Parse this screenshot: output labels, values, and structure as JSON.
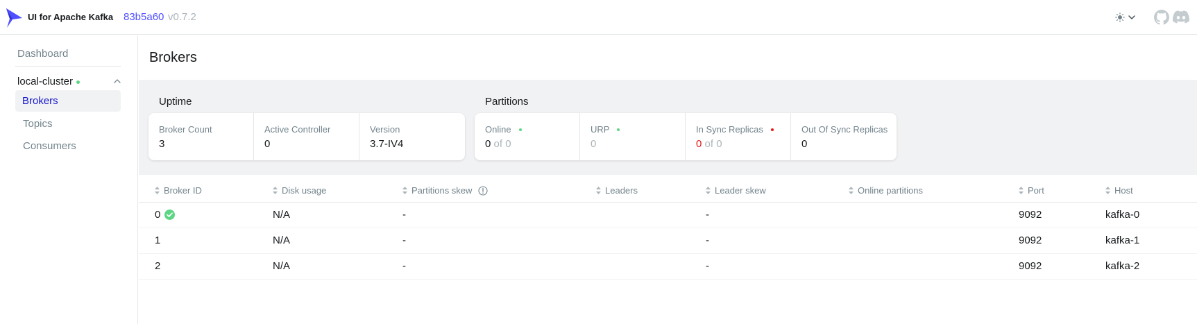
{
  "app": {
    "name": "UI for Apache Kafka",
    "commit": "83b5a60",
    "version": "v0.7.2"
  },
  "sidebar": {
    "dashboard": "Dashboard",
    "cluster": {
      "name": "local-cluster",
      "status_color": "#5CD685"
    },
    "items": [
      {
        "label": "Brokers",
        "active": true
      },
      {
        "label": "Topics",
        "active": false
      },
      {
        "label": "Consumers",
        "active": false
      }
    ]
  },
  "page": {
    "title": "Brokers"
  },
  "uptime": {
    "title": "Uptime",
    "cards": [
      {
        "label": "Broker Count",
        "value": "3"
      },
      {
        "label": "Active Controller",
        "value": "0"
      },
      {
        "label": "Version",
        "value": "3.7-IV4"
      }
    ]
  },
  "partitions": {
    "title": "Partitions",
    "cards": [
      {
        "label": "Online",
        "value": "0",
        "suffix": "of 0",
        "dot_color": "#5CD685"
      },
      {
        "label": "URP",
        "value": "0",
        "dot_color": "#5CD685"
      },
      {
        "label": "In Sync Replicas",
        "value": "0",
        "suffix": "of 0",
        "dot_color": "#E51A1A"
      },
      {
        "label": "Out Of Sync Replicas",
        "value": "0"
      }
    ]
  },
  "table": {
    "columns": [
      "Broker ID",
      "Disk usage",
      "Partitions skew",
      "Leaders",
      "Leader skew",
      "Online partitions",
      "Port",
      "Host"
    ],
    "rows": [
      {
        "broker_id": "0",
        "disk_usage": "N/A",
        "partitions_skew": "-",
        "leaders": "",
        "leader_skew": "-",
        "online_partitions": "",
        "port": "9092",
        "host": "kafka-0",
        "controller": true
      },
      {
        "broker_id": "1",
        "disk_usage": "N/A",
        "partitions_skew": "-",
        "leaders": "",
        "leader_skew": "-",
        "online_partitions": "",
        "port": "9092",
        "host": "kafka-1",
        "controller": false
      },
      {
        "broker_id": "2",
        "disk_usage": "N/A",
        "partitions_skew": "-",
        "leaders": "",
        "leader_skew": "-",
        "online_partitions": "",
        "port": "9092",
        "host": "kafka-2",
        "controller": false
      }
    ]
  },
  "colors": {
    "accent": "#4F4FFF",
    "active_nav": "#1717CF",
    "success": "#5CD685",
    "danger": "#E51A1A"
  }
}
